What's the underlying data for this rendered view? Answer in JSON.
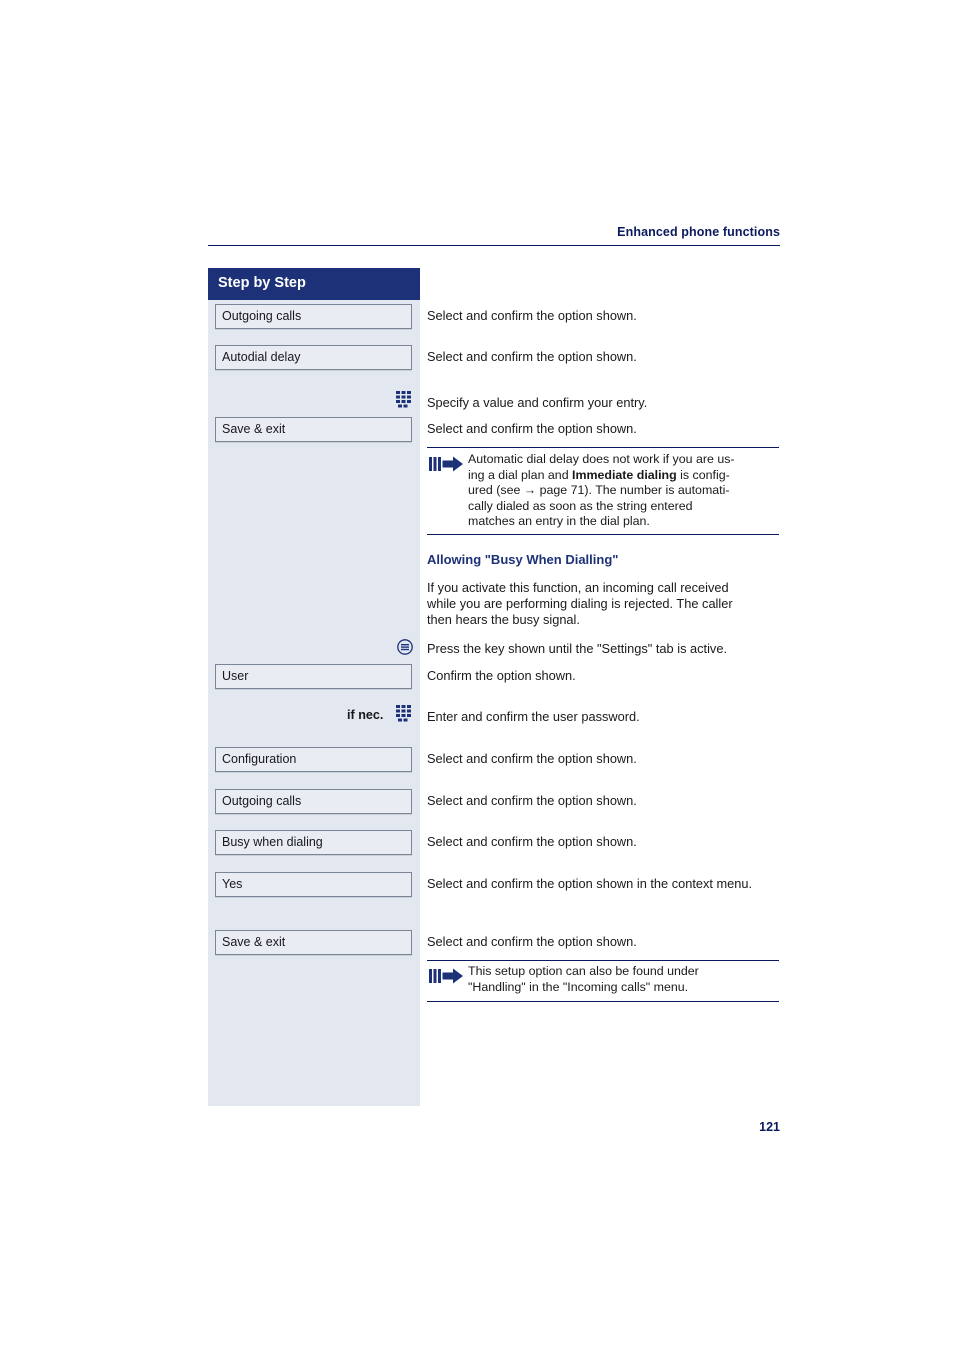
{
  "header": {
    "title": "Enhanced phone functions"
  },
  "sidebar": {
    "title": "Step by Step",
    "items": [
      {
        "label": "Outgoing calls"
      },
      {
        "label": "Autodial delay"
      },
      {
        "label": "Save & exit"
      },
      {
        "label": "User"
      },
      {
        "label": "Configuration"
      },
      {
        "label": "Outgoing calls"
      },
      {
        "label": "Busy when dialing"
      },
      {
        "label": "Yes"
      },
      {
        "label": "Save & exit"
      }
    ],
    "if_nec_label": "if nec."
  },
  "content": {
    "steps": [
      {
        "text": "Select and confirm the option shown."
      },
      {
        "text": "Select and confirm the option shown."
      },
      {
        "text": "Specify a value and confirm your entry."
      },
      {
        "text": "Select and confirm the option shown."
      },
      {
        "text": "Press the key shown until the \"Settings\" tab is active."
      },
      {
        "text": "Confirm the option shown."
      },
      {
        "text": "Enter and confirm the user password."
      },
      {
        "text": "Select and confirm the option shown."
      },
      {
        "text": "Select and confirm the option shown."
      },
      {
        "text": "Select and confirm the option shown."
      },
      {
        "text": "Select and confirm the option shown in the context menu."
      },
      {
        "text": "Select and confirm the option shown."
      }
    ],
    "note1": {
      "line1": "Automatic dial delay does not work if you are us-",
      "line2a": "ing a dial plan and ",
      "line2b": "Immediate dialing",
      "line2c": " is config-",
      "line3": "ured (see → page 71). The number is automati-",
      "line4": "cally dialed as soon as the string entered",
      "line5": "matches an entry in the dial plan."
    },
    "section": {
      "heading": "Allowing \"Busy When Dialling\"",
      "paragraph_line1": "If you activate this function, an incoming call received",
      "paragraph_line2": "while you are performing dialing is rejected. The caller",
      "paragraph_line3": "then hears the busy signal."
    },
    "note2": {
      "line1": "This setup option can also be found under",
      "line2": "\"Handling\" in the \"Incoming calls\" menu."
    }
  },
  "footer": {
    "page_number": "121"
  },
  "colors": {
    "brand_dark_blue": "#1d3178",
    "sidebar_bg": "#e3e8f0",
    "button_bg": "#e9edf3",
    "button_border": "#7b8598"
  }
}
